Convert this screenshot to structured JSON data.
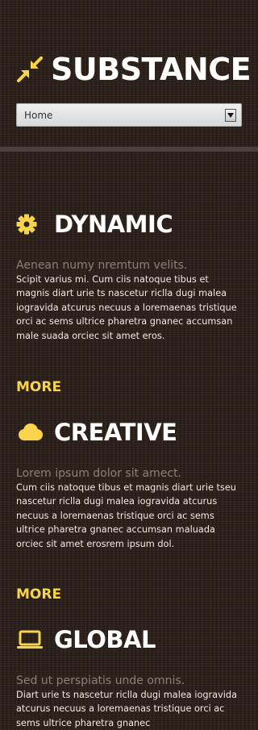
{
  "brand": {
    "name": "SUBSTANCE",
    "icon": "arrows-inward-icon"
  },
  "nav": {
    "selected": "Home"
  },
  "colors": {
    "accent": "#f7d44a",
    "background": "#2e231c",
    "divider": "#4a423d"
  },
  "sections": [
    {
      "title": "DYNAMIC",
      "icon": "gear-icon",
      "subtitle": "Aenean numy nremtum velits.",
      "body": "Scipit varius mi. Cum ciis natoque tibus et magnis diart urie ts nascetur riclla dugi malea iogravida atcurus necuus a loremaenas tristique orci ac sems ultrice pharetra gnanec accumsan male suada orciec sit amet eros.",
      "more": "MORE"
    },
    {
      "title": "CREATIVE",
      "icon": "cloud-icon",
      "subtitle": "Lorem ipsum dolor sit amect.",
      "body": "Cum ciis natoque tibus et magnis diart urie tseu nascetur riclla dugi malea iogravida atcurus necuus a loremaenas tristique orci ac sems ultrice pharetra gnanec accumsan maluada orciec sit amet erosrem ipsum dol.",
      "more": "MORE"
    },
    {
      "title": "GLOBAL",
      "icon": "laptop-icon",
      "subtitle": "Sed ut perspiatis unde omnis.",
      "body": "Diart urie ts nascetur riclla dugi malea iogravida atcurus necuus a loremaenas tristique orci ac sems ultrice pharetra gnanec"
    }
  ]
}
